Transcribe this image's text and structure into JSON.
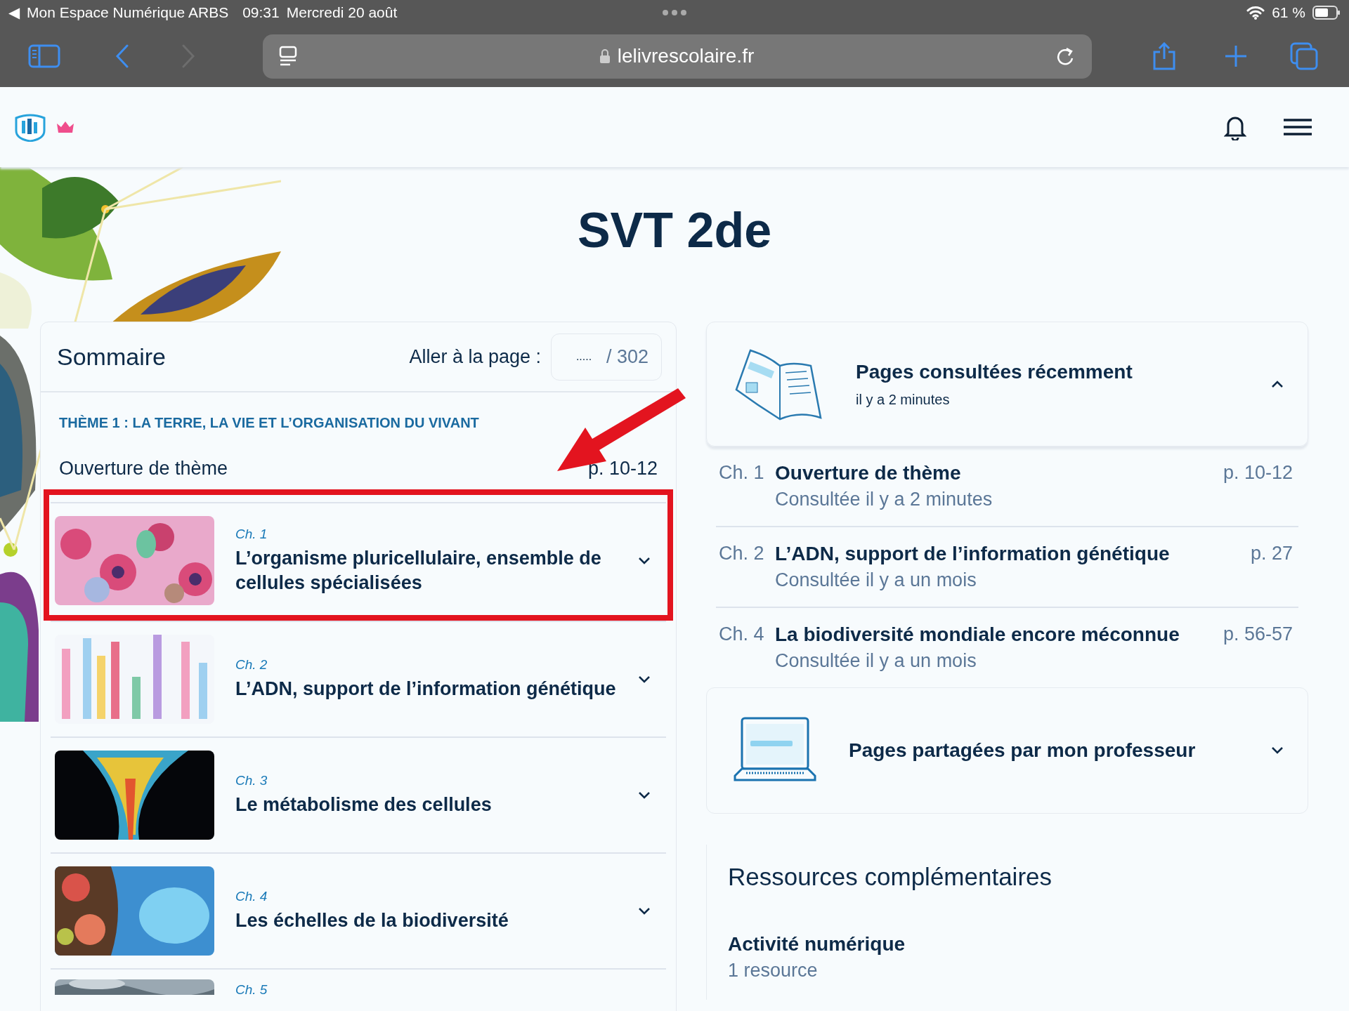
{
  "status_bar": {
    "back_arrow": "◀",
    "back_app": "Mon Espace Numérique ARBS",
    "time": "09:31",
    "date": "Mercredi 20 août",
    "battery": "61 %"
  },
  "browser": {
    "url": "lelivrescolaire.fr"
  },
  "page": {
    "title": "SVT 2de"
  },
  "summary": {
    "title": "Sommaire",
    "goto_label": "Aller à la page :",
    "page_field": {
      "placeholder": ".....",
      "total": "/ 302"
    },
    "theme": "THÈME 1 : LA TERRE, LA VIE ET L’ORGANISATION DU VIVANT",
    "opening": {
      "label": "Ouverture de thème",
      "pages": "p. 10-12"
    },
    "chapters": [
      {
        "number": "Ch. 1",
        "title": "L’organisme pluricellulaire, ensemble de cellules spécialisées",
        "highlighted": true,
        "expanded": false
      },
      {
        "number": "Ch. 2",
        "title": "L’ADN, support de l’information génétique",
        "highlighted": false,
        "expanded": false
      },
      {
        "number": "Ch. 3",
        "title": "Le métabolisme des cellules",
        "highlighted": false,
        "expanded": false
      },
      {
        "number": "Ch. 4",
        "title": "Les échelles de la biodiversité",
        "highlighted": false,
        "expanded": false
      },
      {
        "number": "Ch. 5",
        "highlighted": false
      }
    ]
  },
  "recent": {
    "title": "Pages consultées récemment",
    "subtitle": "il y a 2 minutes",
    "expanded": true,
    "items": [
      {
        "chapter": "Ch. 1",
        "title": "Ouverture de thème",
        "viewed": "Consultée il y a 2 minutes",
        "pages": "p. 10-12"
      },
      {
        "chapter": "Ch. 2",
        "title": "L’ADN, support de l’information génétique",
        "viewed": "Consultée il y a un mois",
        "pages": "p. 27"
      },
      {
        "chapter": "Ch. 4",
        "title": "La biodiversité mondiale encore méconnue",
        "viewed": "Consultée il y a un mois",
        "pages": "p. 56-57"
      }
    ]
  },
  "shared": {
    "title": "Pages partagées par mon professeur",
    "expanded": false
  },
  "resources": {
    "title": "Ressources complémentaires",
    "items": [
      {
        "title": "Activité numérique",
        "count": "1 resource"
      }
    ]
  }
}
